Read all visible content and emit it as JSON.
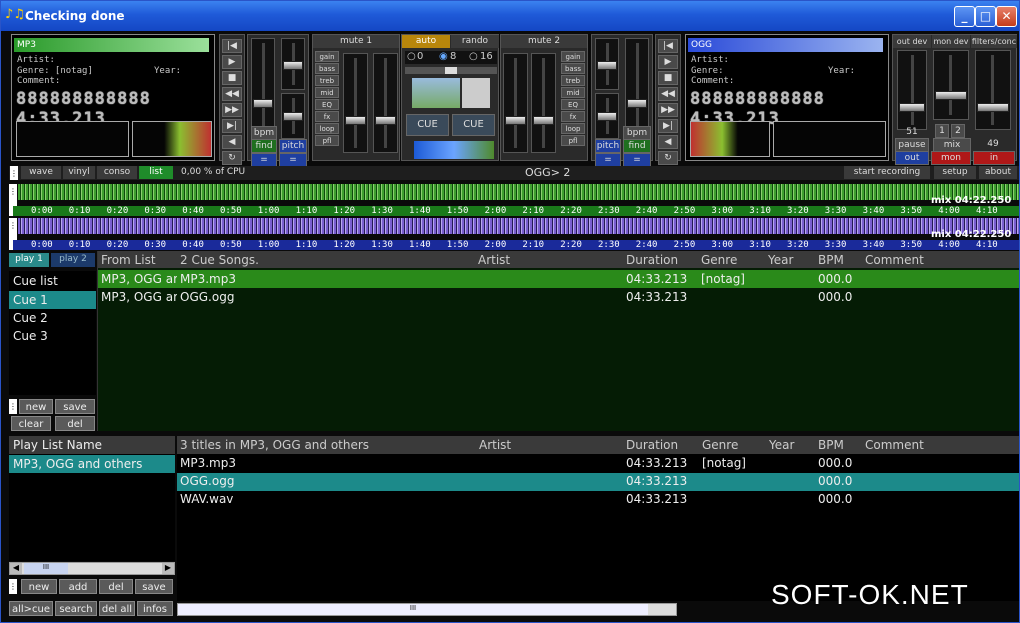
{
  "window": {
    "title": "Checking done",
    "minimize": "_",
    "maximize": "□",
    "close": "✕"
  },
  "deck1": {
    "name": "MP3",
    "artist_label": "Artist:",
    "genre_label": "Genre: [notag]",
    "year_label": "Year:",
    "comment_label": "Comment:",
    "counter": "888888888888 4:33.213",
    "bpm": "bpm",
    "find": "find",
    "pitch": "pitch",
    "pitch_value": "="
  },
  "deck2": {
    "name": "OGG",
    "artist_label": "Artist:",
    "genre_label": "Genre:",
    "year_label": "Year:",
    "comment_label": "Comment:",
    "counter": "888888888888 4:33.213",
    "bpm": "bpm",
    "find": "find",
    "pitch": "pitch",
    "pitch_value": "="
  },
  "mixer": {
    "mute1": "mute 1",
    "mute2": "mute 2",
    "auto": "auto",
    "rando": "rando",
    "opt0": "0",
    "opt8": "8",
    "opt16": "16",
    "cue": "CUE",
    "gain_labels": [
      "gain",
      "bass",
      "treb",
      "mid",
      "EQ",
      "fx",
      "loop",
      "pfl"
    ]
  },
  "master": {
    "out_dev": "out dev",
    "mon_dev": "mon dev",
    "filters": "filters/conc",
    "level1": "51",
    "level2": "49",
    "pause": "pause",
    "mix": "mix",
    "out": "out",
    "mon": "mon",
    "in": "in",
    "a": "1",
    "b": "2"
  },
  "toolbar": {
    "wave": "wave",
    "vinyl": "vinyl",
    "conso": "conso",
    "list": "list",
    "cpu": "0,00  % of CPU",
    "now": "OGG> 2",
    "start_recording": "start recording",
    "setup": "setup",
    "about": "about"
  },
  "wave1": {
    "mix": "mix 04:22.250",
    "ticks": [
      "0:00",
      "0:10",
      "0:20",
      "0:30",
      "0:40",
      "0:50",
      "1:00",
      "1:10",
      "1:20",
      "1:30",
      "1:40",
      "1:50",
      "2:00",
      "2:10",
      "2:20",
      "2:30",
      "2:40",
      "2:50",
      "3:00",
      "3:10",
      "3:20",
      "3:30",
      "3:40",
      "3:50",
      "4:00",
      "4:10"
    ]
  },
  "wave2": {
    "mix": "mix 04:22.250",
    "ticks": [
      "0:00",
      "0:10",
      "0:20",
      "0:30",
      "0:40",
      "0:50",
      "1:00",
      "1:10",
      "1:20",
      "1:30",
      "1:40",
      "1:50",
      "2:00",
      "2:10",
      "2:20",
      "2:30",
      "2:40",
      "2:50",
      "3:00",
      "3:10",
      "3:20",
      "3:30",
      "3:40",
      "3:50",
      "4:00",
      "4:10"
    ]
  },
  "cues": {
    "play1": "play 1",
    "play2": "play 2",
    "items": [
      "Cue list",
      "Cue 1",
      "Cue 2",
      "Cue 3"
    ],
    "new": "new",
    "save": "save",
    "clear": "clear",
    "del": "del"
  },
  "cuetable": {
    "headers": [
      "From List",
      "2 Cue Songs.",
      "Artist",
      "Duration",
      "Genre",
      "Year",
      "BPM",
      "Comment"
    ],
    "rows": [
      [
        "MP3, OGG ar",
        "MP3.mp3",
        "",
        "04:33.213",
        "[notag]",
        "",
        "000.0",
        ""
      ],
      [
        "MP3, OGG ar",
        "OGG.ogg",
        "",
        "04:33.213",
        "",
        "",
        "000.0",
        ""
      ]
    ]
  },
  "playlists": {
    "header": "Play List Name",
    "items": [
      "MP3, OGG and others"
    ],
    "scroll": "III",
    "new": "new",
    "add": "add",
    "del": "del",
    "save": "save",
    "allcue": "all>cue",
    "search": "search",
    "delall": "del all",
    "infos": "infos"
  },
  "titletable": {
    "headers": [
      "3 titles in MP3, OGG and others",
      "Artist",
      "Duration",
      "Genre",
      "Year",
      "BPM",
      "Comment"
    ],
    "rows": [
      [
        "MP3.mp3",
        "",
        "04:33.213",
        "[notag]",
        "",
        "000.0",
        ""
      ],
      [
        "OGG.ogg",
        "",
        "04:33.213",
        "",
        "",
        "000.0",
        ""
      ],
      [
        "WAV.wav",
        "",
        "04:33.213",
        "",
        "",
        "000.0",
        ""
      ]
    ],
    "scroll": "III"
  },
  "watermark": {
    "text": "SOFT-OK.NET"
  }
}
